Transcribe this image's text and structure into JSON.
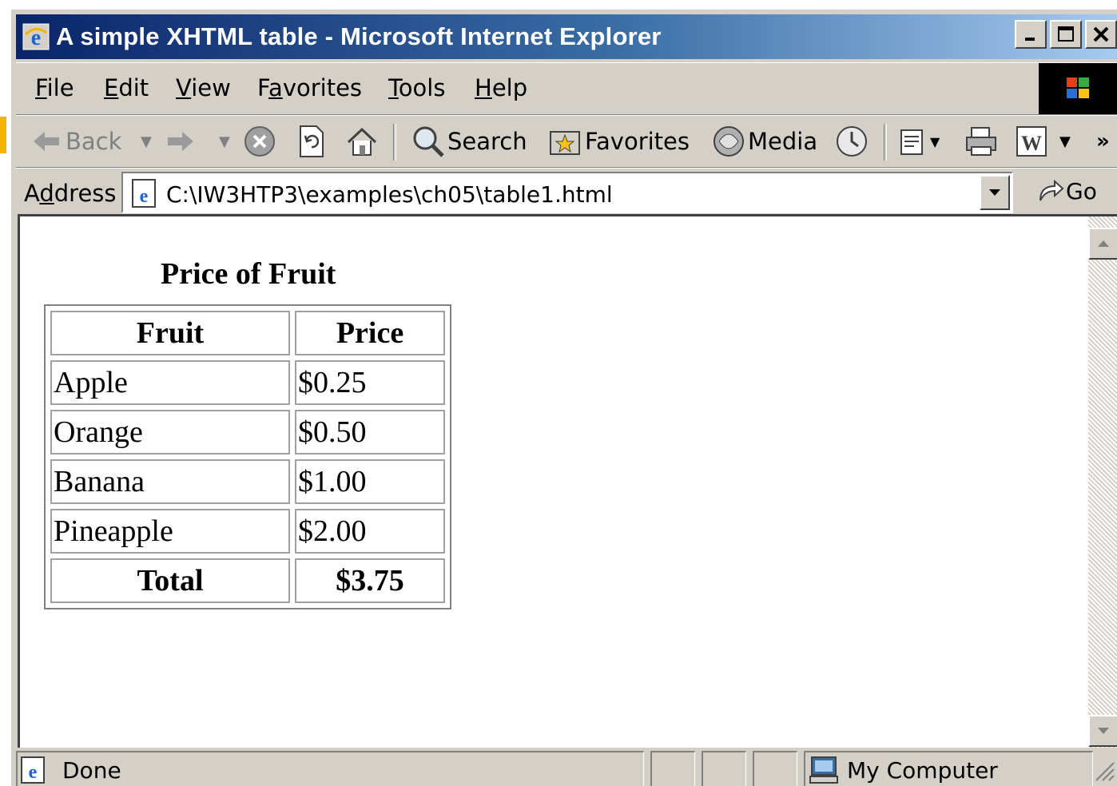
{
  "window": {
    "title": "A simple XHTML table - Microsoft Internet Explorer",
    "controls": {
      "minimize": "_",
      "maximize": "☐",
      "close": "✕"
    }
  },
  "menubar": {
    "items": [
      {
        "label": "File",
        "accel": "F",
        "rest": "ile"
      },
      {
        "label": "Edit",
        "accel": "E",
        "rest": "dit"
      },
      {
        "label": "View",
        "accel": "V",
        "rest": "iew"
      },
      {
        "label": "Favorites",
        "pre": "F",
        "accel": "a",
        "rest": "vorites"
      },
      {
        "label": "Tools",
        "accel": "T",
        "rest": "ools"
      },
      {
        "label": "Help",
        "accel": "H",
        "rest": "elp"
      }
    ]
  },
  "toolbar": {
    "back_label": "Back",
    "search_label": "Search",
    "favorites_label": "Favorites",
    "media_label": "Media",
    "more": "»"
  },
  "address": {
    "label": "Address",
    "url": "C:\\IW3HTP3\\examples\\ch05\\table1.html",
    "go_label": "Go"
  },
  "page": {
    "caption": "Price of Fruit",
    "table": {
      "headers": [
        "Fruit",
        "Price"
      ],
      "rows": [
        [
          "Apple",
          "$0.25"
        ],
        [
          "Orange",
          "$0.50"
        ],
        [
          "Banana",
          "$1.00"
        ],
        [
          "Pineapple",
          "$2.00"
        ]
      ],
      "footer": [
        "Total",
        "$3.75"
      ]
    }
  },
  "status": {
    "text": "Done",
    "zone": "My Computer"
  }
}
